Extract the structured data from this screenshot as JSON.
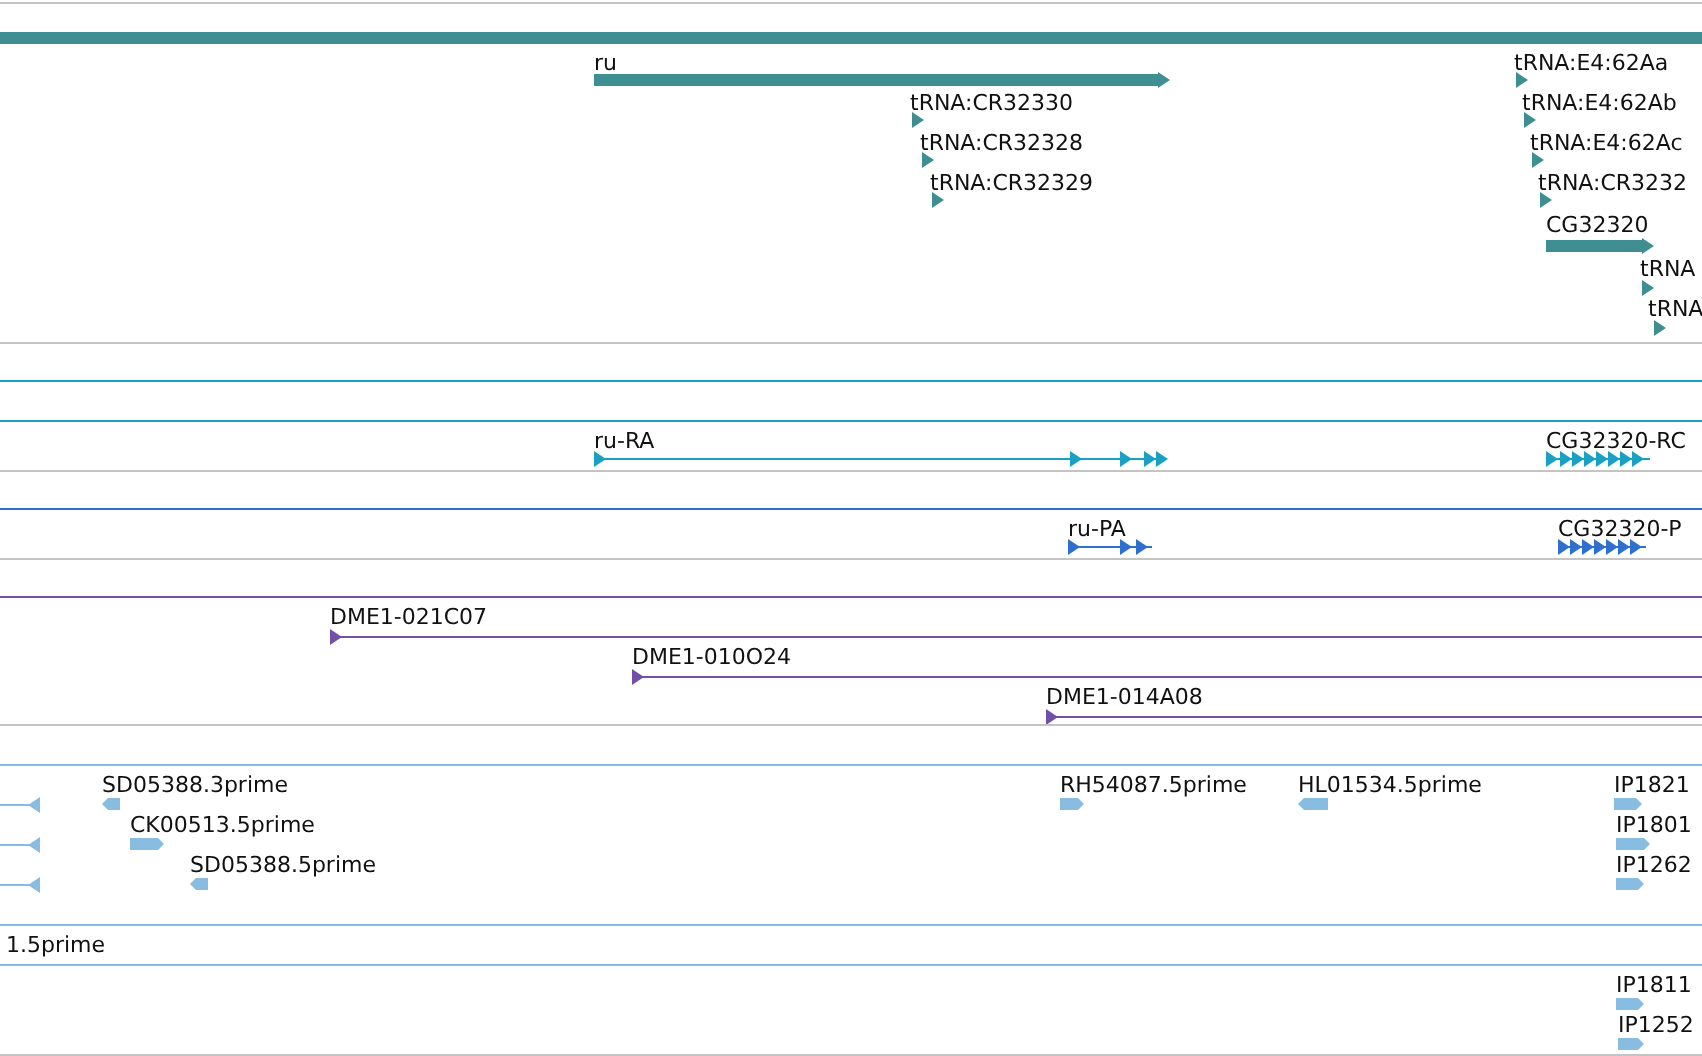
{
  "tracks": [
    {
      "color": "#3f8e92",
      "features": [
        {
          "kind": "bar"
        },
        {
          "kind": "bar",
          "label": "ru",
          "reverse": false
        },
        {
          "kind": "tick",
          "label": "tRNA:CR32330",
          "reverse": false
        },
        {
          "kind": "tick",
          "label": "tRNA:CR32328",
          "reverse": false
        },
        {
          "kind": "tick",
          "label": "tRNA:CR32329",
          "reverse": false
        },
        {
          "kind": "tick",
          "label": "tRNA:E4:62Aa",
          "reverse": false
        },
        {
          "kind": "tick",
          "label": "tRNA:E4:62Ab",
          "reverse": false
        },
        {
          "kind": "tick",
          "label": "tRNA:E4:62Ac",
          "reverse": false
        },
        {
          "kind": "tick",
          "label": "tRNA:CR3232",
          "reverse": false
        },
        {
          "kind": "bar",
          "label": "CG32320",
          "reverse": false
        },
        {
          "kind": "tick",
          "label": "tRNA",
          "reverse": false
        },
        {
          "kind": "tick",
          "label": "tRNA",
          "reverse": false
        }
      ]
    },
    {
      "color": "#1aa0c2",
      "features": [
        {
          "kind": "span"
        },
        {
          "kind": "span"
        },
        {
          "kind": "transcript",
          "label": "ru-RA",
          "reverse": false
        },
        {
          "kind": "transcript",
          "label": "CG32320-RC",
          "reverse": false
        }
      ]
    },
    {
      "color": "#2e6fd0",
      "features": [
        {
          "kind": "span"
        },
        {
          "kind": "transcript",
          "label": "ru-PA",
          "reverse": false
        },
        {
          "kind": "transcript",
          "label": "CG32320-P",
          "reverse": false
        }
      ]
    },
    {
      "color": "#7250a8",
      "features": [
        {
          "kind": "span"
        },
        {
          "kind": "line",
          "label": "DME1-021C07",
          "reverse": false
        },
        {
          "kind": "line",
          "label": "DME1-010O24",
          "reverse": false
        },
        {
          "kind": "line",
          "label": "DME1-014A08",
          "reverse": false
        }
      ]
    },
    {
      "color": "#88bce0",
      "features": [
        {
          "kind": "line",
          "reverse": true
        },
        {
          "kind": "line",
          "reverse": true
        },
        {
          "kind": "line",
          "reverse": true
        },
        {
          "kind": "block",
          "label": "SD05388.3prime",
          "reverse": true
        },
        {
          "kind": "block",
          "label": "CK00513.5prime",
          "reverse": false
        },
        {
          "kind": "block",
          "label": "SD05388.5prime",
          "reverse": true
        },
        {
          "kind": "block",
          "label": "RH54087.5prime",
          "reverse": false
        },
        {
          "kind": "block",
          "label": "HL01534.5prime",
          "reverse": true
        },
        {
          "kind": "block",
          "label": "IP1821",
          "reverse": false
        },
        {
          "kind": "block",
          "label": "IP1801",
          "reverse": false
        },
        {
          "kind": "block",
          "label": "IP1262",
          "reverse": false
        }
      ]
    },
    {
      "color": "#88bce0",
      "features": [
        {
          "kind": "label",
          "label": "1.5prime"
        }
      ]
    },
    {
      "color": "#88bce0",
      "features": [
        {
          "kind": "block",
          "label": "IP1811",
          "reverse": false
        },
        {
          "kind": "block",
          "label": "IP1252",
          "reverse": false
        }
      ]
    }
  ]
}
